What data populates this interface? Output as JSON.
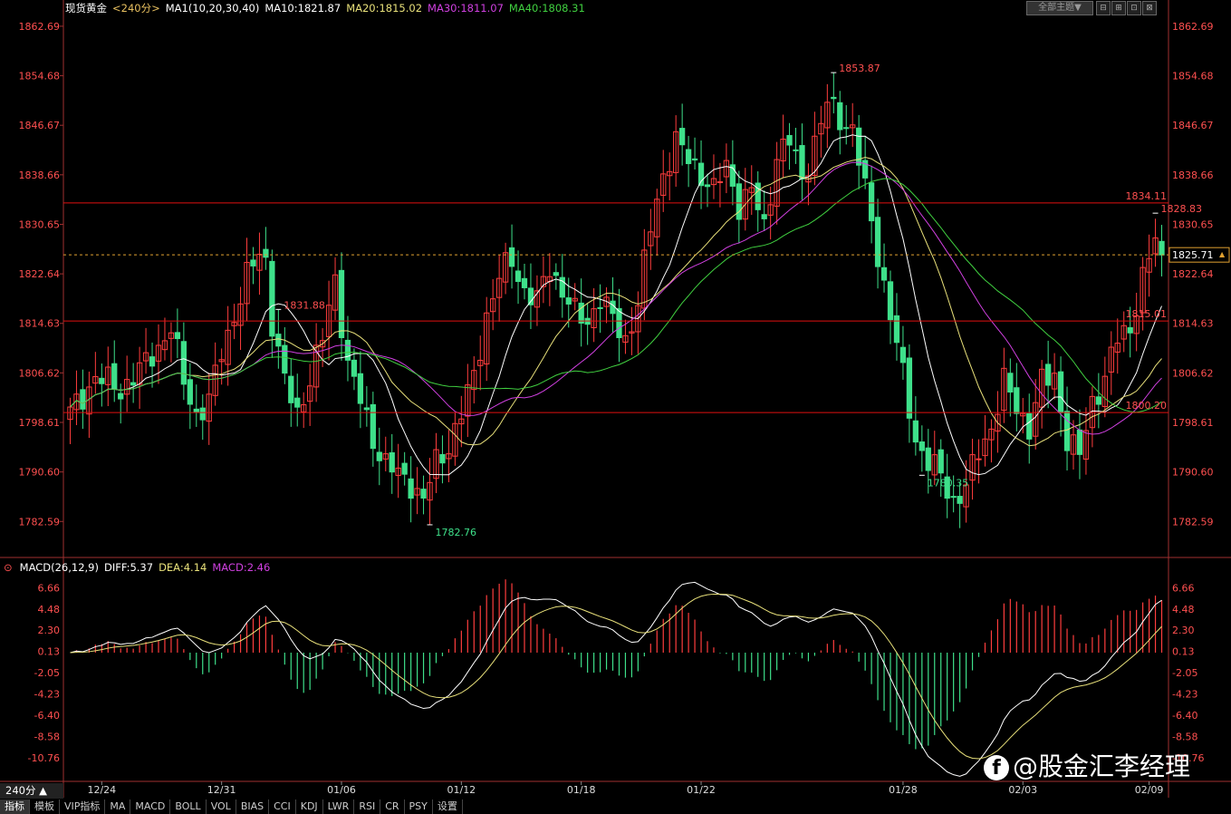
{
  "header": {
    "instrument": "现货黄金",
    "period": "<240分>",
    "indicator": "MA1(10,20,30,40)",
    "ma10": "MA10:1821.87",
    "ma20": "MA20:1815.02",
    "ma30": "MA30:1811.07",
    "ma40": "MA40:1808.31",
    "theme_label": "全部主题▼",
    "win_buttons": [
      "⊟",
      "⊞",
      "⊡",
      "⊠"
    ]
  },
  "colors": {
    "up": "#ff3d3d",
    "down": "#3ee08a",
    "ma10": "#ffffff",
    "ma20": "#e8e07a",
    "ma30": "#d040e0",
    "ma40": "#40d040",
    "level": "#e01010",
    "label": "#ff5050",
    "grid": "#a03030"
  },
  "price_axis": {
    "ticks": [
      "1862.69",
      "1854.68",
      "1846.67",
      "1838.66",
      "1830.65",
      "1822.64",
      "1814.63",
      "1806.62",
      "1798.61",
      "1790.60",
      "1782.59"
    ],
    "min": 1777.5,
    "max": 1864.0
  },
  "levels": [
    {
      "value": 1834.11,
      "label": "1834.11",
      "style": "solid"
    },
    {
      "value": 1815.01,
      "label": "1815.01",
      "style": "solid"
    },
    {
      "value": 1800.2,
      "label": "1800.20",
      "style": "solid"
    },
    {
      "value": 1825.71,
      "label": "1825.71",
      "style": "dashed"
    }
  ],
  "price_annotations": [
    {
      "text": "1831.88",
      "index": 33,
      "type": "high"
    },
    {
      "text": "1853.87",
      "index": 121,
      "type": "high"
    },
    {
      "text": "1828.83",
      "index": 172,
      "type": "high"
    },
    {
      "text": "1782.76",
      "index": 57,
      "type": "low"
    },
    {
      "text": "1780.35",
      "index": 135,
      "type": "low"
    }
  ],
  "current_price_label": "1825.71",
  "macd_header": {
    "name": "MACD(26,12,9)",
    "diff": "DIFF:5.37",
    "dea": "DEA:4.14",
    "macd": "MACD:2.46"
  },
  "macd_axis": {
    "ticks": [
      "6.66",
      "4.48",
      "2.30",
      "0.13",
      "-2.05",
      "-4.23",
      "-6.40",
      "-8.58",
      "-10.76"
    ],
    "min": -13.0,
    "max": 7.8
  },
  "date_axis": [
    {
      "label": "12/24",
      "index": 5
    },
    {
      "label": "12/31",
      "index": 24
    },
    {
      "label": "01/06",
      "index": 43
    },
    {
      "label": "01/12",
      "index": 62
    },
    {
      "label": "01/18",
      "index": 81
    },
    {
      "label": "01/22",
      "index": 100
    },
    {
      "label": "01/28",
      "index": 132
    },
    {
      "label": "02/03",
      "index": 151
    },
    {
      "label": "02/09",
      "index": 171
    }
  ],
  "period_label": "240分 ▲",
  "tabs": [
    "指标",
    "模板",
    "VIP指标",
    "MA",
    "MACD",
    "BOLL",
    "VOL",
    "BIAS",
    "CCI",
    "KDJ",
    "LWR",
    "RSI",
    "CR",
    "PSY",
    "设置"
  ],
  "watermark": "@股金汇李经理",
  "chart_data": {
    "type": "candlestick",
    "title": "现货黄金",
    "interval": "240分",
    "close_anchors": [
      [
        0,
        1800
      ],
      [
        4,
        1806
      ],
      [
        8,
        1804
      ],
      [
        12,
        1808
      ],
      [
        16,
        1814
      ],
      [
        18,
        1805
      ],
      [
        20,
        1800
      ],
      [
        22,
        1802
      ],
      [
        24,
        1810
      ],
      [
        26,
        1816
      ],
      [
        28,
        1822
      ],
      [
        30,
        1826
      ],
      [
        31,
        1825
      ],
      [
        32,
        1815
      ],
      [
        34,
        1805
      ],
      [
        36,
        1800
      ],
      [
        38,
        1806
      ],
      [
        40,
        1812
      ],
      [
        42,
        1822
      ],
      [
        44,
        1808
      ],
      [
        46,
        1802
      ],
      [
        48,
        1796
      ],
      [
        50,
        1792
      ],
      [
        52,
        1790
      ],
      [
        54,
        1789
      ],
      [
        56,
        1786
      ],
      [
        58,
        1792
      ],
      [
        60,
        1795
      ],
      [
        62,
        1800
      ],
      [
        64,
        1806
      ],
      [
        66,
        1816
      ],
      [
        68,
        1822
      ],
      [
        70,
        1825
      ],
      [
        72,
        1820
      ],
      [
        74,
        1818
      ],
      [
        76,
        1824
      ],
      [
        78,
        1820
      ],
      [
        80,
        1816
      ],
      [
        82,
        1815
      ],
      [
        84,
        1819
      ],
      [
        86,
        1815
      ],
      [
        88,
        1812
      ],
      [
        90,
        1818
      ],
      [
        92,
        1830
      ],
      [
        94,
        1839
      ],
      [
        96,
        1844
      ],
      [
        98,
        1841
      ],
      [
        100,
        1839
      ],
      [
        102,
        1836
      ],
      [
        104,
        1840
      ],
      [
        106,
        1834
      ],
      [
        108,
        1836
      ],
      [
        110,
        1830
      ],
      [
        112,
        1842
      ],
      [
        114,
        1844
      ],
      [
        116,
        1838
      ],
      [
        118,
        1844
      ],
      [
        120,
        1850
      ],
      [
        122,
        1848
      ],
      [
        124,
        1846
      ],
      [
        126,
        1836
      ],
      [
        128,
        1826
      ],
      [
        130,
        1816
      ],
      [
        132,
        1806
      ],
      [
        134,
        1796
      ],
      [
        136,
        1792
      ],
      [
        138,
        1790
      ],
      [
        140,
        1786
      ],
      [
        142,
        1788
      ],
      [
        144,
        1794
      ],
      [
        146,
        1798
      ],
      [
        148,
        1805
      ],
      [
        150,
        1801
      ],
      [
        152,
        1798
      ],
      [
        154,
        1805
      ],
      [
        156,
        1806
      ],
      [
        158,
        1796
      ],
      [
        160,
        1793
      ],
      [
        162,
        1802
      ],
      [
        164,
        1806
      ],
      [
        166,
        1812
      ],
      [
        168,
        1814
      ],
      [
        170,
        1822
      ],
      [
        172,
        1828
      ],
      [
        173,
        1825.7
      ]
    ],
    "ma_series": [
      "MA10",
      "MA20",
      "MA30",
      "MA40"
    ],
    "macd": {
      "fast": 26,
      "slow": 12,
      "signal": 9,
      "diff": 5.37,
      "dea": 4.14,
      "macd": 2.46
    }
  }
}
